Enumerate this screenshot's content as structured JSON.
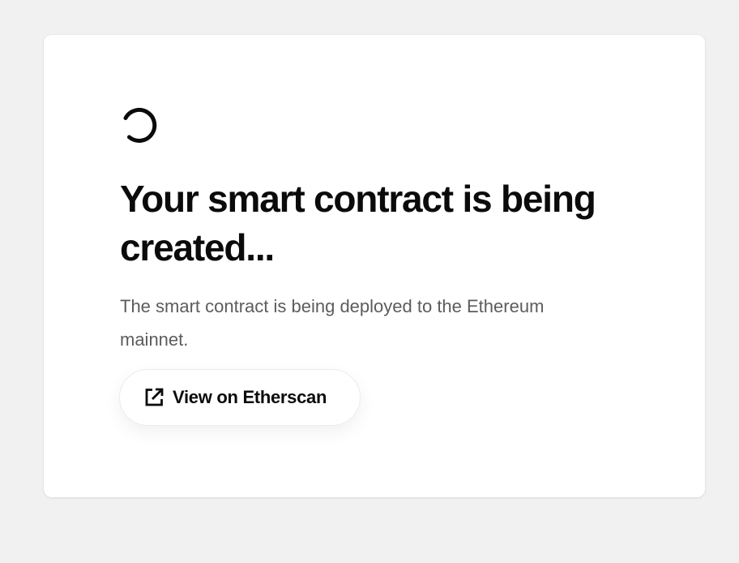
{
  "status": {
    "title": "Your smart contract is being created...",
    "description": "The smart contract is being deployed to the Ethereum mainnet."
  },
  "actions": {
    "view_on_explorer_label": "View on Etherscan"
  },
  "icons": {
    "loading": "loading-spinner-icon",
    "external": "external-link-icon"
  },
  "colors": {
    "background": "#f1f1f1",
    "card": "#ffffff",
    "title": "#0b0b0b",
    "description": "#5c5c5c"
  }
}
